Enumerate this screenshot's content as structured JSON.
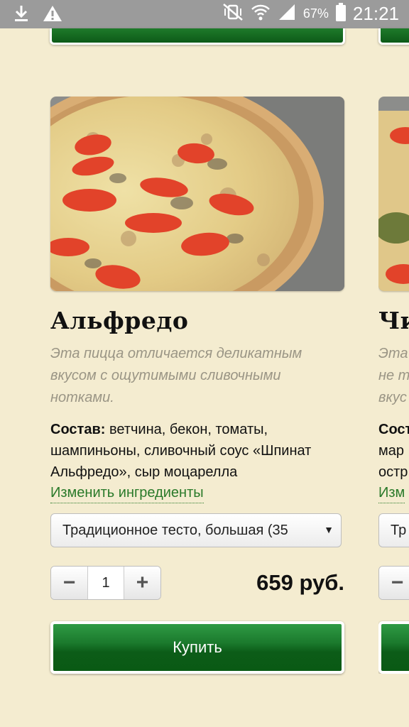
{
  "status_bar": {
    "battery": "67%",
    "time": "21:21"
  },
  "product": {
    "name": "Альфредо",
    "description": "Эта пицца отличается деликатным вкусом с ощутимыми сливочными нотками.",
    "composition_label": "Состав:",
    "composition": "ветчина, бекон, томаты, шампиньоны, сливочный соус «Шпинат Альфредо», сыр моцарелла",
    "change_link": "Изменить ингредиенты",
    "size_select": "Традиционное тесто, большая (35",
    "quantity": "1",
    "price": "659 руб.",
    "buy_label": "Купить"
  },
  "next_product": {
    "name": "Чи",
    "description_lines": [
      "Эта",
      "не т",
      "вкус"
    ],
    "composition_label": "Сост",
    "composition_lines": [
      "мар",
      "остр"
    ],
    "change_link": "Изм",
    "size_select": "Тр"
  }
}
